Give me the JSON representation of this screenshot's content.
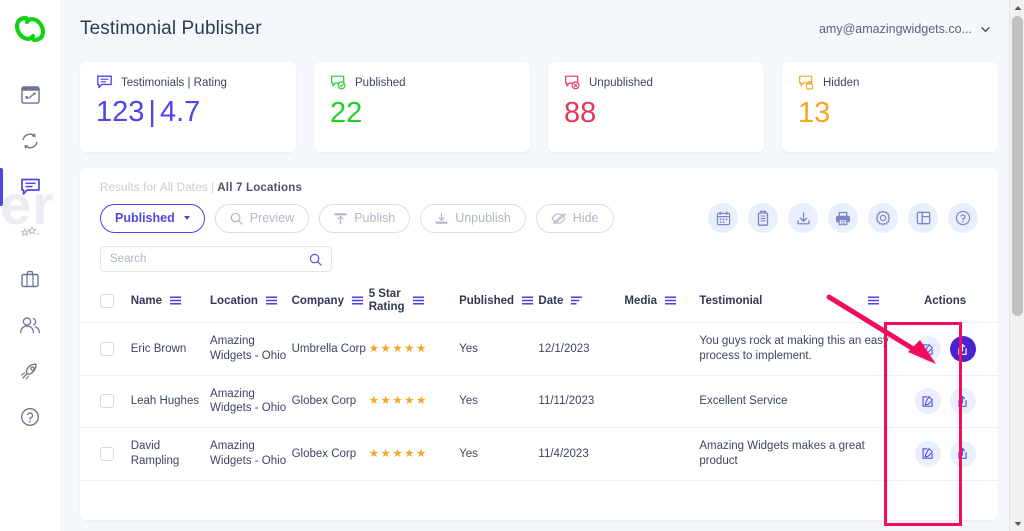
{
  "app": {
    "logo": "chain-link-logo",
    "title": "Testimonial Publisher",
    "account_email": "amy@amazingwidgets.co...",
    "accent": "#4f46e5",
    "annotation_color": "#f20d5c",
    "watermark": "er"
  },
  "sidebar": {
    "items": [
      {
        "name": "dashboard",
        "icon": "dashboard-icon",
        "active": false
      },
      {
        "name": "sync",
        "icon": "sync-icon",
        "active": false
      },
      {
        "name": "testimonials",
        "icon": "chat-bubble-icon",
        "active": true
      },
      {
        "name": "reviews",
        "icon": "stars-icon",
        "active": false
      },
      {
        "name": "business",
        "icon": "briefcase-icon",
        "active": false
      },
      {
        "name": "customers",
        "icon": "users-icon",
        "active": false
      },
      {
        "name": "campaigns",
        "icon": "rocket-icon",
        "active": false
      },
      {
        "name": "help",
        "icon": "help-circle-icon",
        "active": false
      }
    ]
  },
  "stats": [
    {
      "label": "Testimonials | Rating",
      "count": "123",
      "divider": "|",
      "rating": "4.7",
      "color": "#4f46e5",
      "icon": "chat-bubble-icon"
    },
    {
      "label": "Published",
      "value": "22",
      "color": "#24cf2a",
      "icon": "chat-check-icon"
    },
    {
      "label": "Unpublished",
      "value": "88",
      "color": "#e8355e",
      "icon": "chat-x-icon"
    },
    {
      "label": "Hidden",
      "value": "13",
      "color": "#f5a623",
      "icon": "chat-lock-icon"
    }
  ],
  "panel": {
    "results_line": "Results for All Dates | All 7 Locations",
    "filters": [
      {
        "label": "Published",
        "icon": "caret-down-icon",
        "primary": true
      },
      {
        "label": "Preview",
        "icon": "search-icon",
        "primary": false
      },
      {
        "label": "Publish",
        "icon": "publish-icon",
        "primary": false
      },
      {
        "label": "Unpublish",
        "icon": "unpublish-icon",
        "primary": false
      },
      {
        "label": "Hide",
        "icon": "eye-off-icon",
        "primary": false
      }
    ],
    "tools": [
      {
        "name": "calendar-icon"
      },
      {
        "name": "building-icon"
      },
      {
        "name": "download-icon"
      },
      {
        "name": "printer-icon"
      },
      {
        "name": "gear-icon"
      },
      {
        "name": "layout-columns-icon"
      },
      {
        "name": "help-circle-icon"
      }
    ],
    "search": {
      "value": "",
      "placeholder": "Search",
      "icon": "search-icon"
    }
  },
  "table": {
    "columns": [
      {
        "key": "checkbox",
        "label": "",
        "sortable": false
      },
      {
        "key": "name",
        "label": "Name",
        "sortable": true
      },
      {
        "key": "location",
        "label": "Location",
        "sortable": true
      },
      {
        "key": "company",
        "label": "Company",
        "sortable": true
      },
      {
        "key": "rating",
        "label": "5 Star Rating",
        "sortable": true
      },
      {
        "key": "published",
        "label": "Published",
        "sortable": true
      },
      {
        "key": "date",
        "label": "Date",
        "sortable": true,
        "sorted": true
      },
      {
        "key": "media",
        "label": "Media",
        "sortable": true
      },
      {
        "key": "testimonial",
        "label": "Testimonial",
        "sortable": true
      },
      {
        "key": "actions",
        "label": "Actions",
        "sortable": false
      }
    ],
    "rows": [
      {
        "name": "Eric Brown",
        "location": "Amazing Widgets - Ohio",
        "company": "Umbrella Corp",
        "rating": 5,
        "published": "Yes",
        "date": "12/1/2023",
        "media": "",
        "testimonial": "You guys rock at making this an easy process to implement.",
        "actions": [
          {
            "name": "edit-icon",
            "highlighted": false
          },
          {
            "name": "share-icon",
            "highlighted": true
          }
        ]
      },
      {
        "name": "Leah Hughes",
        "location": "Amazing Widgets - Ohio",
        "company": "Globex Corp",
        "rating": 5,
        "published": "Yes",
        "date": "11/11/2023",
        "media": "",
        "testimonial": "Excellent Service",
        "actions": [
          {
            "name": "edit-icon",
            "highlighted": false
          },
          {
            "name": "share-icon",
            "highlighted": false
          }
        ]
      },
      {
        "name": "David Rampling",
        "location": "Amazing Widgets - Ohio",
        "company": "Globex Corp",
        "rating": 5,
        "published": "Yes",
        "date": "11/4/2023",
        "media": "",
        "testimonial": "Amazing Widgets makes a great product",
        "actions": [
          {
            "name": "edit-icon",
            "highlighted": false
          },
          {
            "name": "share-icon",
            "highlighted": false
          }
        ]
      }
    ]
  }
}
